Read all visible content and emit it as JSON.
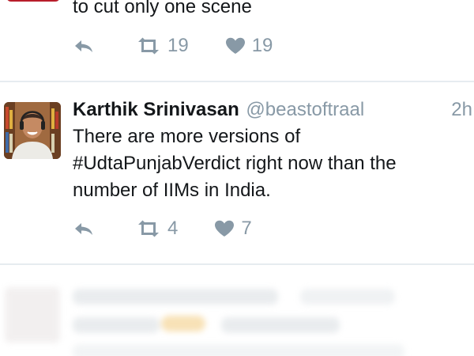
{
  "tweets": [
    {
      "text_tail": "to cut only one scene",
      "retweets": "19",
      "likes": "19"
    },
    {
      "name": "Karthik Srinivasan",
      "handle": "@beastoftraal",
      "time": "2h",
      "lines": [
        "There are more versions of",
        "#UdtaPunjabVerdict right now than the",
        "number of IIMs in India."
      ],
      "retweets": "4",
      "likes": "7"
    }
  ],
  "icons": {
    "reply": "reply-icon",
    "retweet": "retweet-icon",
    "like": "heart-icon"
  },
  "colors": {
    "muted": "#8899a6",
    "text": "#14171a",
    "divider": "#e6ecf0"
  }
}
